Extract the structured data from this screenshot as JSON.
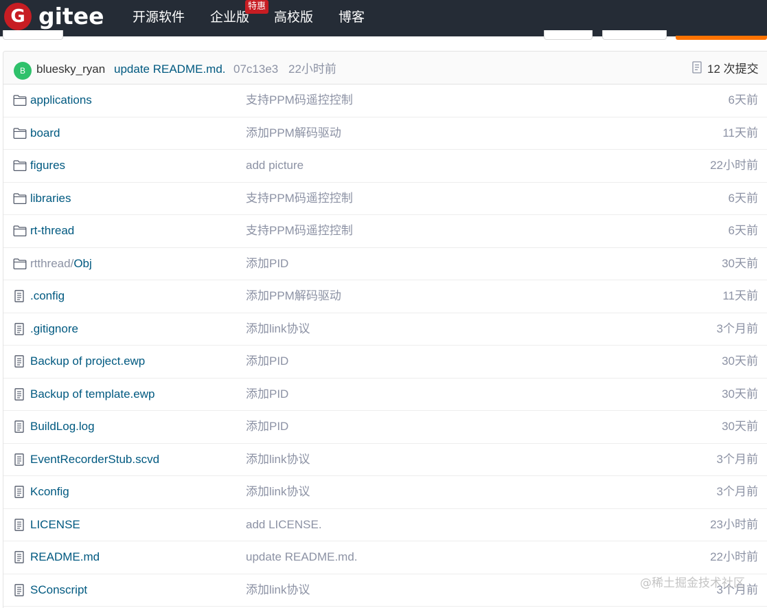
{
  "header": {
    "logo_letter": "G",
    "brand": "gitee",
    "nav": [
      "开源软件",
      "企业版",
      "高校版",
      "博客"
    ],
    "badge": "特惠"
  },
  "commit": {
    "avatar_letter": "B",
    "author": "bluesky_ryan",
    "message": "update README.md.",
    "hash": "07c13e3",
    "time": "22小时前",
    "count_label": "12 次提交"
  },
  "files": [
    {
      "type": "folder",
      "prefix": "",
      "name": "applications",
      "message": "支持PPM码遥控控制",
      "time": "6天前"
    },
    {
      "type": "folder",
      "prefix": "",
      "name": "board",
      "message": "添加PPM解码驱动",
      "time": "11天前"
    },
    {
      "type": "folder",
      "prefix": "",
      "name": "figures",
      "message": "add picture",
      "time": "22小时前"
    },
    {
      "type": "folder",
      "prefix": "",
      "name": "libraries",
      "message": "支持PPM码遥控控制",
      "time": "6天前"
    },
    {
      "type": "folder",
      "prefix": "",
      "name": "rt-thread",
      "message": "支持PPM码遥控控制",
      "time": "6天前"
    },
    {
      "type": "folder",
      "prefix": "rtthread/",
      "name": "Obj",
      "message": "添加PID",
      "time": "30天前"
    },
    {
      "type": "file",
      "prefix": "",
      "name": ".config",
      "message": "添加PPM解码驱动",
      "time": "11天前"
    },
    {
      "type": "file",
      "prefix": "",
      "name": ".gitignore",
      "message": "添加link协议",
      "time": "3个月前"
    },
    {
      "type": "file",
      "prefix": "",
      "name": "Backup of project.ewp",
      "message": "添加PID",
      "time": "30天前"
    },
    {
      "type": "file",
      "prefix": "",
      "name": "Backup of template.ewp",
      "message": "添加PID",
      "time": "30天前"
    },
    {
      "type": "file",
      "prefix": "",
      "name": "BuildLog.log",
      "message": "添加PID",
      "time": "30天前"
    },
    {
      "type": "file",
      "prefix": "",
      "name": "EventRecorderStub.scvd",
      "message": "添加link协议",
      "time": "3个月前"
    },
    {
      "type": "file",
      "prefix": "",
      "name": "Kconfig",
      "message": "添加link协议",
      "time": "3个月前"
    },
    {
      "type": "file",
      "prefix": "",
      "name": "LICENSE",
      "message": "add LICENSE.",
      "time": "23小时前"
    },
    {
      "type": "file",
      "prefix": "",
      "name": "README.md",
      "message": "update README.md.",
      "time": "22小时前"
    },
    {
      "type": "file",
      "prefix": "",
      "name": "SConscript",
      "message": "添加link协议",
      "time": "3个月前"
    }
  ],
  "watermark": "@稀土掘金技术社区",
  "colors": {
    "header_bg": "#252c36",
    "brand_red": "#c71d23",
    "link": "#005980",
    "muted": "#8c92a4",
    "avatar": "#2fc16b",
    "accent_orange": "#fe7300"
  },
  "icons": {
    "folder": "folder-icon",
    "file": "file-icon",
    "commits": "commit-history-icon"
  }
}
